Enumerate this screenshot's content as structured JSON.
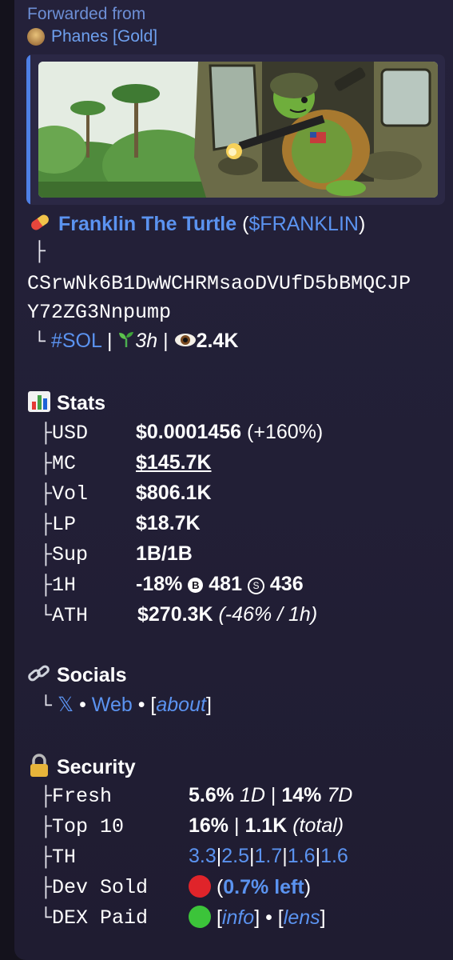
{
  "forward": {
    "label": "Forwarded from",
    "channel": "Phanes [Gold]"
  },
  "token": {
    "emoji_icon": "pill-icon",
    "name": "Franklin The Turtle",
    "ticker_open": " (",
    "ticker": "$FRANKLIN",
    "ticker_close": ")",
    "address_branch": "├",
    "address_line1": "CSrwNk6B1DwWCHRMsaoDVUfD5bBMQCJP",
    "address_line2": "Y72ZG3Nnpump",
    "meta_branch": "└",
    "chain": "#SOL",
    "sep": "|",
    "age": "3h",
    "views": "2.4K"
  },
  "stats": {
    "title": "Stats",
    "rows": [
      {
        "branch": "├",
        "label": "USD",
        "value": "$0.0001456",
        "extra": " (+160%)"
      },
      {
        "branch": "├",
        "label": "MC",
        "value": "$145.7K"
      },
      {
        "branch": "├",
        "label": "Vol",
        "value": "$806.1K"
      },
      {
        "branch": "├",
        "label": "LP",
        "value": "$18.7K"
      },
      {
        "branch": "├",
        "label": "Sup",
        "value": "1B/1B"
      },
      {
        "branch": "├",
        "label": "1H",
        "value": "-18%",
        "buys_icon": "B",
        "buys": "481",
        "sells_icon": "S",
        "sells": "436"
      },
      {
        "branch": "└",
        "label": "ATH",
        "value": "$270.3K",
        "extra": "(-46% / 1h)"
      }
    ]
  },
  "socials": {
    "title": "Socials",
    "branch": "└",
    "x_label": "𝕏",
    "dot": "•",
    "web_label": "Web",
    "bracket_open": "[",
    "about_label": "about",
    "bracket_close": "]"
  },
  "security": {
    "title": "Security",
    "fresh": {
      "branch": "├",
      "label": "Fresh",
      "v1": "5.6%",
      "p1": "1D",
      "sep": "|",
      "v2": "14%",
      "p2": "7D"
    },
    "top10": {
      "branch": "├",
      "label": "Top 10",
      "v1": "16%",
      "sep": "|",
      "v2": "1.1K",
      "note": "(total)"
    },
    "th": {
      "branch": "├",
      "label": "TH",
      "values": [
        "3.3",
        "2.5",
        "1.7",
        "1.6",
        "1.6"
      ],
      "sep": "|"
    },
    "dev_sold": {
      "branch": "├",
      "label": "Dev Sold",
      "status_color": "#e0242a",
      "open": "(",
      "pct": "0.7% left",
      "close": ")"
    },
    "dex_paid": {
      "branch": "└",
      "label": "DEX Paid",
      "status_color": "#3cc43a",
      "open": "[",
      "info": "info",
      "mid": "] • [",
      "lens": "lens",
      "close": "]"
    }
  },
  "colors": {
    "link": "#5b93f0",
    "bubble": "#23203a"
  }
}
